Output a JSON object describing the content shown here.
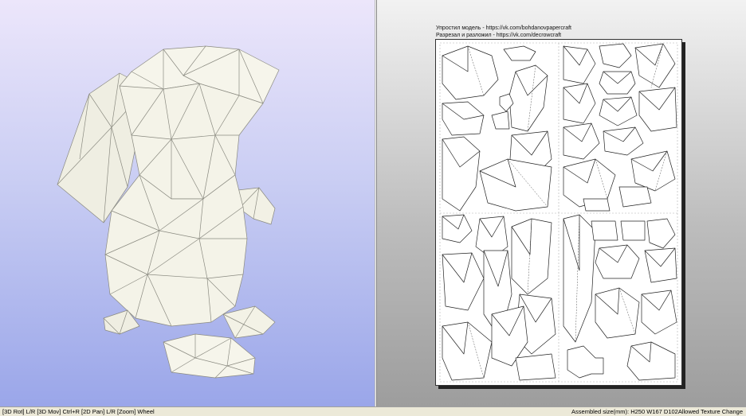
{
  "credits": {
    "line1": "Упростил модель - https://vk.com/bohdanovpapercraft",
    "line2": "Разрезал и разложил - https://vk.com/decrowcraft"
  },
  "statusbar": {
    "left": "[3D Rot] L/R [3D Mov] Ctrl+R [2D Pan] L/R [Zoom] Wheel",
    "right": "Assembled size(mm): H250 W167 D102Allowed Texture Change"
  },
  "colors": {
    "model_fill": "#f4f3e8",
    "model_edge": "#8a8a80",
    "viewport_top": "#ece6fb",
    "viewport_bottom": "#9aa6e9"
  }
}
